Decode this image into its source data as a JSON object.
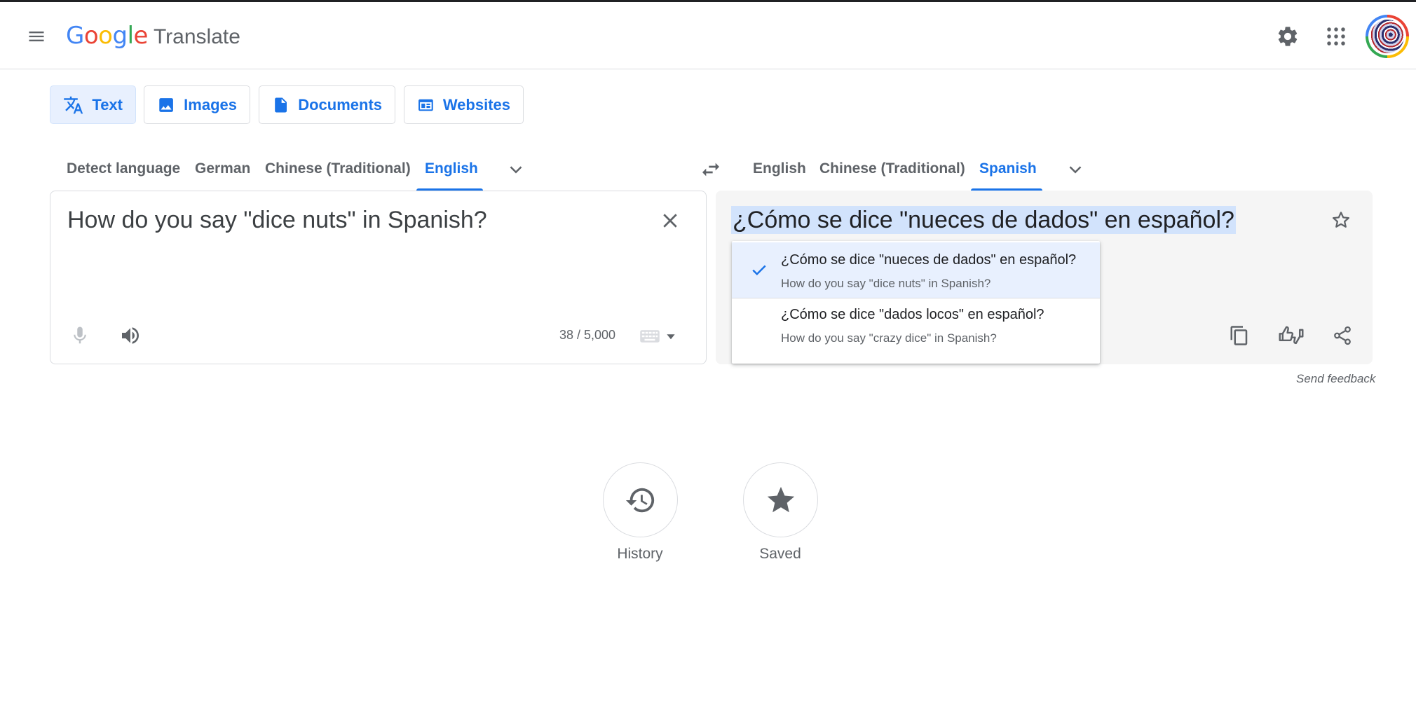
{
  "header": {
    "logo_letters": [
      {
        "ch": "G",
        "color": "#4285F4"
      },
      {
        "ch": "o",
        "color": "#EA4335"
      },
      {
        "ch": "o",
        "color": "#FBBC04"
      },
      {
        "ch": "g",
        "color": "#4285F4"
      },
      {
        "ch": "l",
        "color": "#34A853"
      },
      {
        "ch": "e",
        "color": "#EA4335"
      }
    ],
    "product_name": "Translate",
    "icons": [
      "menu-icon",
      "settings-icon",
      "apps-icon",
      "avatar"
    ]
  },
  "modes": [
    {
      "label": "Text",
      "icon": "translate-icon",
      "active": true
    },
    {
      "label": "Images",
      "icon": "image-icon",
      "active": false
    },
    {
      "label": "Documents",
      "icon": "document-icon",
      "active": false
    },
    {
      "label": "Websites",
      "icon": "website-icon",
      "active": false
    }
  ],
  "source_languages": {
    "tabs": [
      "Detect language",
      "German",
      "Chinese (Traditional)",
      "English"
    ],
    "selected": "English"
  },
  "target_languages": {
    "tabs": [
      "English",
      "Chinese (Traditional)",
      "Spanish"
    ],
    "selected": "Spanish"
  },
  "source": {
    "text": "How do you say \"dice nuts\" in Spanish?",
    "char_count": "38 / 5,000"
  },
  "target": {
    "text": "¿Cómo se dice \"nueces de dados\" en español?"
  },
  "alternatives": [
    {
      "translation": "¿Cómo se dice \"nueces de dados\" en español?",
      "back_translation": "How do you say \"dice nuts\" in Spanish?",
      "selected": true
    },
    {
      "translation": "¿Cómo se dice \"dados locos\" en español?",
      "back_translation": "How do you say \"crazy dice\" in Spanish?",
      "selected": false
    }
  ],
  "feedback_label": "Send feedback",
  "bottom": {
    "history_label": "History",
    "saved_label": "Saved"
  },
  "colors": {
    "accent": "#1a73e8",
    "selection_highlight": "#d2e3fc",
    "active_tab_bg": "#e8f0fe"
  }
}
